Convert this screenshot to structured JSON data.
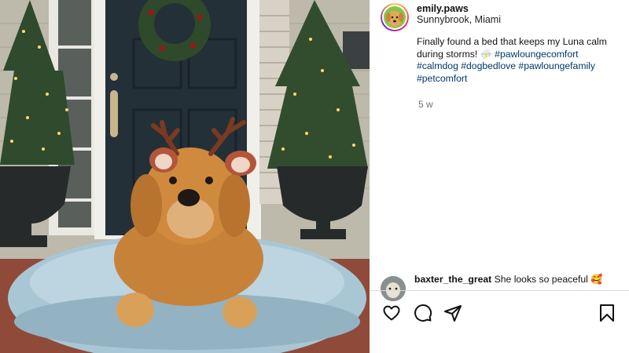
{
  "post": {
    "username": "emily.paws",
    "location": "Sunnybrook, Miami",
    "caption_text": "Finally found a bed that keeps my Luna calm during storms! ⛈️",
    "caption_tags": "#pawloungecomfort #calmdog #dogbedlove #pawloungefamily #petcomfort",
    "time": "5 w"
  },
  "comment": {
    "username": "baxter_the_great",
    "text": "She looks so peaceful 🥰"
  },
  "actions": {
    "like_icon": "heart-icon",
    "comment_icon": "comment-bubble-icon",
    "share_icon": "paper-plane-icon",
    "save_icon": "bookmark-icon"
  },
  "colors": {
    "hashtag": "#00376b",
    "muted": "#737373",
    "door": "#243038",
    "bed": "#a9c6d4",
    "dog": "#d08a3e"
  }
}
